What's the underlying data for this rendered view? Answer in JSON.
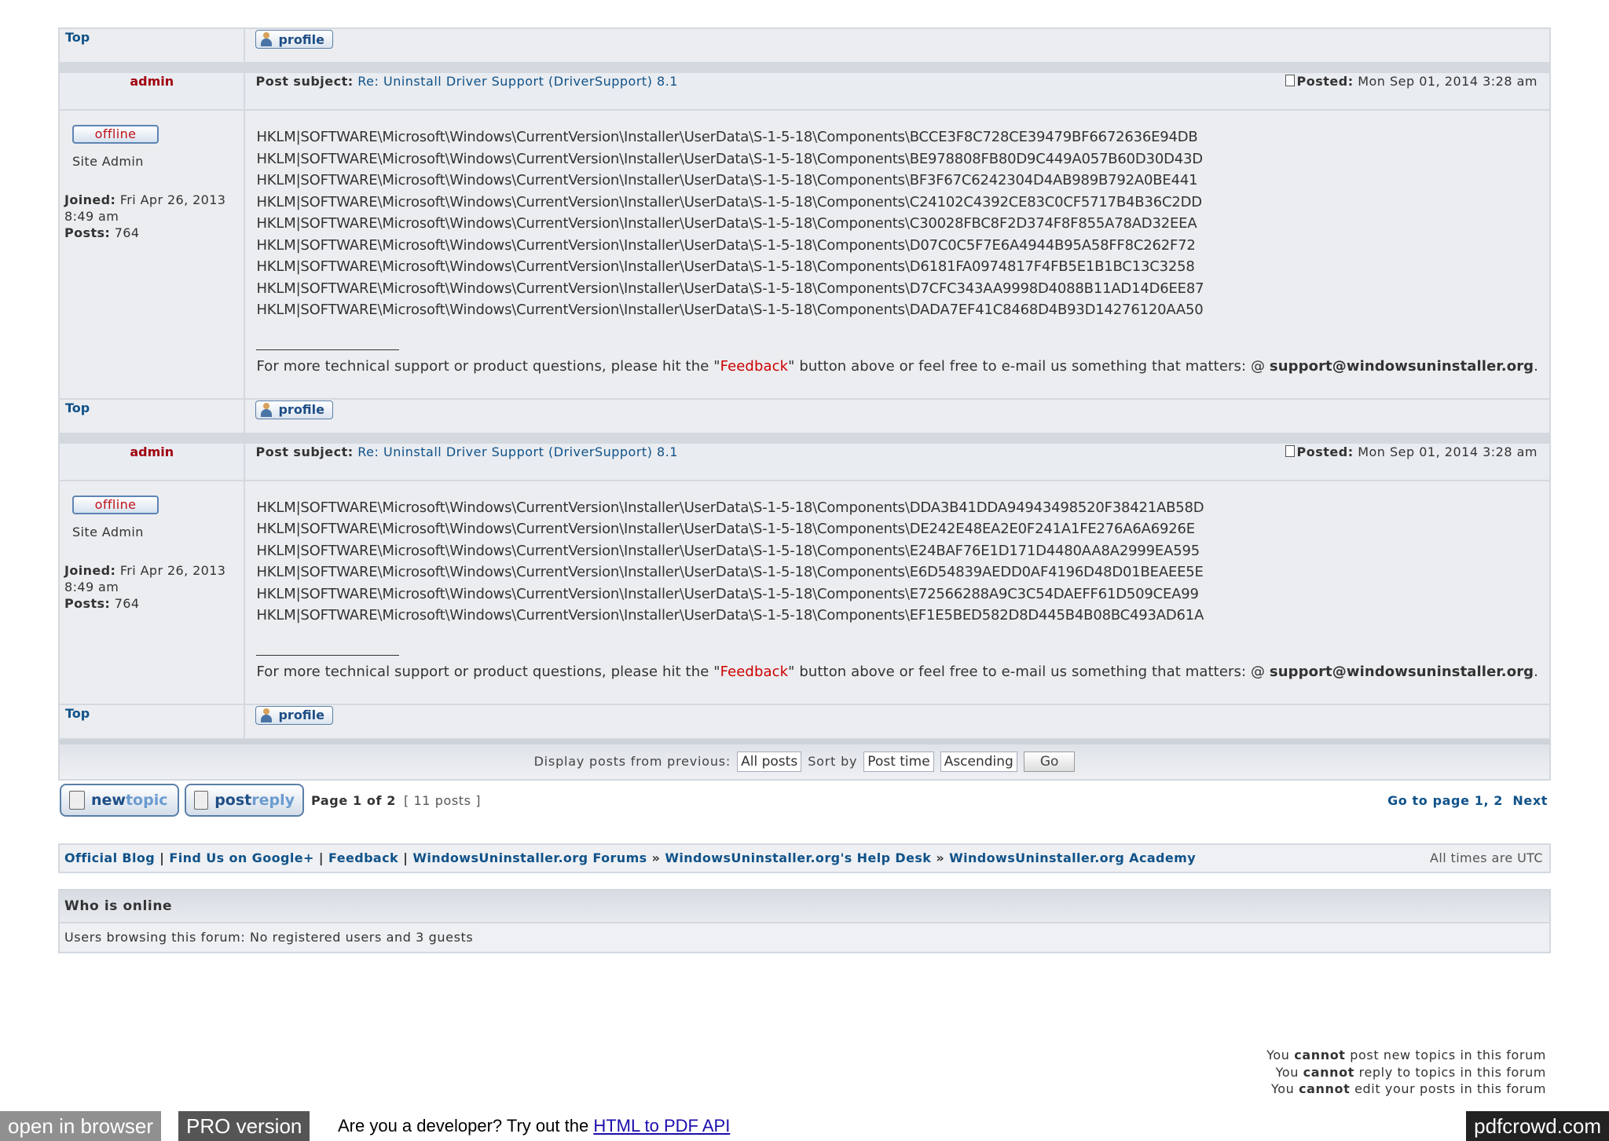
{
  "top_label": "Top",
  "profile_label": "profile",
  "offline_label": "offline",
  "posts": [
    {
      "author": "admin",
      "subject_label": "Post subject:",
      "subject": "Re: Uninstall Driver Support (DriverSupport) 8.1",
      "posted_label": "Posted:",
      "posted": "Mon Sep 01, 2014 3:28 am",
      "rank": "Site Admin",
      "joined_label": "Joined:",
      "joined": "Fri Apr 26, 2013 8:49 am",
      "posts_label": "Posts:",
      "posts_count": "764",
      "lines": [
        "HKLM|SOFTWARE\\Microsoft\\Windows\\CurrentVersion\\Installer\\UserData\\S-1-5-18\\Components\\BCCE3F8C728CE39479BF6672636E94DB",
        "HKLM|SOFTWARE\\Microsoft\\Windows\\CurrentVersion\\Installer\\UserData\\S-1-5-18\\Components\\BE978808FB80D9C449A057B60D30D43D",
        "HKLM|SOFTWARE\\Microsoft\\Windows\\CurrentVersion\\Installer\\UserData\\S-1-5-18\\Components\\BF3F67C6242304D4AB989B792A0BE441",
        "HKLM|SOFTWARE\\Microsoft\\Windows\\CurrentVersion\\Installer\\UserData\\S-1-5-18\\Components\\C24102C4392CE83C0CF5717B4B36C2DD",
        "HKLM|SOFTWARE\\Microsoft\\Windows\\CurrentVersion\\Installer\\UserData\\S-1-5-18\\Components\\C30028FBC8F2D374F8F855A78AD32EEA",
        "HKLM|SOFTWARE\\Microsoft\\Windows\\CurrentVersion\\Installer\\UserData\\S-1-5-18\\Components\\D07C0C5F7E6A4944B95A58FF8C262F72",
        "HKLM|SOFTWARE\\Microsoft\\Windows\\CurrentVersion\\Installer\\UserData\\S-1-5-18\\Components\\D6181FA0974817F4FB5E1B1BC13C3258",
        "HKLM|SOFTWARE\\Microsoft\\Windows\\CurrentVersion\\Installer\\UserData\\S-1-5-18\\Components\\D7CFC343AA9998D4088B11AD14D6EE87",
        "HKLM|SOFTWARE\\Microsoft\\Windows\\CurrentVersion\\Installer\\UserData\\S-1-5-18\\Components\\DADA7EF41C8468D4B93D14276120AA50"
      ]
    },
    {
      "author": "admin",
      "subject_label": "Post subject:",
      "subject": "Re: Uninstall Driver Support (DriverSupport) 8.1",
      "posted_label": "Posted:",
      "posted": "Mon Sep 01, 2014 3:28 am",
      "rank": "Site Admin",
      "joined_label": "Joined:",
      "joined": "Fri Apr 26, 2013 8:49 am",
      "posts_label": "Posts:",
      "posts_count": "764",
      "lines": [
        "HKLM|SOFTWARE\\Microsoft\\Windows\\CurrentVersion\\Installer\\UserData\\S-1-5-18\\Components\\DDA3B41DDA94943498520F38421AB58D",
        "HKLM|SOFTWARE\\Microsoft\\Windows\\CurrentVersion\\Installer\\UserData\\S-1-5-18\\Components\\DE242E48EA2E0F241A1FE276A6A6926E",
        "HKLM|SOFTWARE\\Microsoft\\Windows\\CurrentVersion\\Installer\\UserData\\S-1-5-18\\Components\\E24BAF76E1D171D4480AA8A2999EA595",
        "HKLM|SOFTWARE\\Microsoft\\Windows\\CurrentVersion\\Installer\\UserData\\S-1-5-18\\Components\\E6D54839AEDD0AF4196D48D01BEAEE5E",
        "HKLM|SOFTWARE\\Microsoft\\Windows\\CurrentVersion\\Installer\\UserData\\S-1-5-18\\Components\\E72566288A9C3C54DAEFF61D509CEA99",
        "HKLM|SOFTWARE\\Microsoft\\Windows\\CurrentVersion\\Installer\\UserData\\S-1-5-18\\Components\\EF1E5BED582D8D445B4B08BC493AD61A"
      ]
    }
  ],
  "signature": {
    "line": "________________",
    "prefix": "For more technical support or product questions, please hit the \"",
    "link": "Feedback",
    "middle": "\" button above or feel free to e-mail us something that matters: @ ",
    "email": "support@windowsuninstaller.org",
    "suffix": "."
  },
  "sortbar": {
    "display_label": "Display posts from previous:",
    "display_value": "All posts",
    "sort_label": "Sort by",
    "sort_value": "Post time",
    "order_value": "Ascending",
    "go_label": "Go"
  },
  "actions": {
    "newtopic_a": "new",
    "newtopic_b": "topic",
    "postreply_a": "post",
    "postreply_b": "reply",
    "page_text": "Page 1 of 2",
    "posts_text": "[ 11 posts ]",
    "goto_label": "Go to page",
    "page1": "1",
    "page2": "2",
    "next": "Next"
  },
  "nav": {
    "blog": "Official Blog",
    "google": "Find Us on Google+",
    "feedback": "Feedback",
    "forums": "WindowsUninstaller.org Forums",
    "helpdesk": "WindowsUninstaller.org's Help Desk",
    "academy": "WindowsUninstaller.org Academy",
    "timezone": "All times are UTC"
  },
  "who": {
    "title": "Who is online",
    "text": "Users browsing this forum: No registered users and 3 guests"
  },
  "permissions": [
    {
      "pre": "You ",
      "bold": "cannot",
      "post": " post new topics in this forum"
    },
    {
      "pre": "You ",
      "bold": "cannot",
      "post": " reply to topics in this forum"
    },
    {
      "pre": "You ",
      "bold": "cannot",
      "post": " edit your posts in this forum"
    }
  ],
  "pdfbar": {
    "open": "open in browser",
    "pro": "PRO version",
    "dev_text": "Are you a developer? Try out the ",
    "dev_link": "HTML to PDF API",
    "brand": "pdfcrowd.com"
  }
}
